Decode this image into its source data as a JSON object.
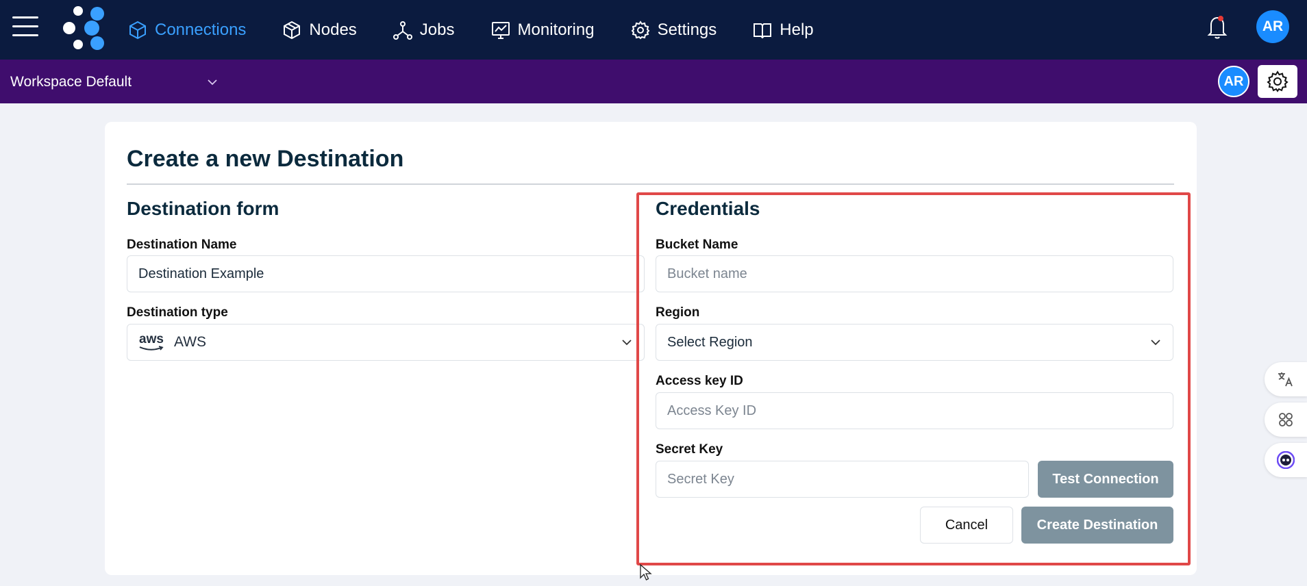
{
  "nav": {
    "items": [
      {
        "label": "Connections",
        "icon": "cube-icon",
        "active": true
      },
      {
        "label": "Nodes",
        "icon": "boxes-icon",
        "active": false
      },
      {
        "label": "Jobs",
        "icon": "network-icon",
        "active": false
      },
      {
        "label": "Monitoring",
        "icon": "chart-monitor-icon",
        "active": false
      },
      {
        "label": "Settings",
        "icon": "gear-icon",
        "active": false
      },
      {
        "label": "Help",
        "icon": "book-icon",
        "active": false
      }
    ],
    "avatar_initials": "AR",
    "active_color": "#3aa0ff",
    "background": "#0b1b3f"
  },
  "workspace": {
    "selected": "Workspace Default",
    "avatar_initials": "AR",
    "background": "#3f0d6d"
  },
  "page": {
    "title": "Create a new Destination"
  },
  "destination_form": {
    "title": "Destination form",
    "name_label": "Destination Name",
    "name_value": "Destination Example",
    "type_label": "Destination type",
    "type_logo": "aws",
    "type_value": "AWS"
  },
  "credentials": {
    "title": "Credentials",
    "bucket_label": "Bucket Name",
    "bucket_placeholder": "Bucket name",
    "region_label": "Region",
    "region_value": "Select Region",
    "access_label": "Access key ID",
    "access_placeholder": "Access Key ID",
    "secret_label": "Secret Key",
    "secret_placeholder": "Secret Key",
    "test_button": "Test Connection",
    "cancel_button": "Cancel",
    "create_button": "Create Destination",
    "highlight_color": "#e04848"
  }
}
